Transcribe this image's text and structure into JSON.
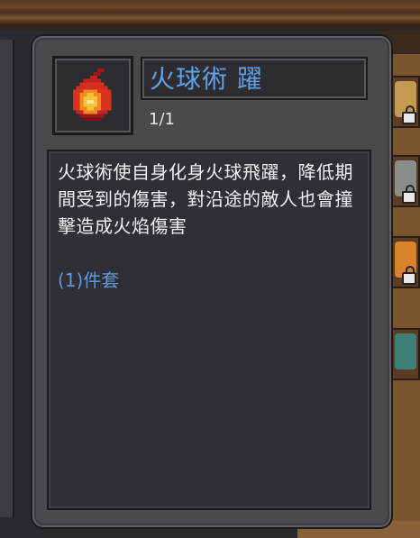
{
  "tooltip": {
    "icon": "fireball-icon",
    "title": "火球術 躍",
    "level": "1/1",
    "description": "火球術使自身化身火球飛躍，降低期間受到的傷害，對沿途的敵人也會撞擊造成火焰傷害",
    "set_label": "(1)件套"
  },
  "colors": {
    "title": "#5fa0e6",
    "set_label": "#5f97d8",
    "panel": "#49494e",
    "inner_box": "#2f2f35"
  },
  "background": {
    "side_slots_locked": [
      true,
      true,
      true,
      true
    ]
  }
}
